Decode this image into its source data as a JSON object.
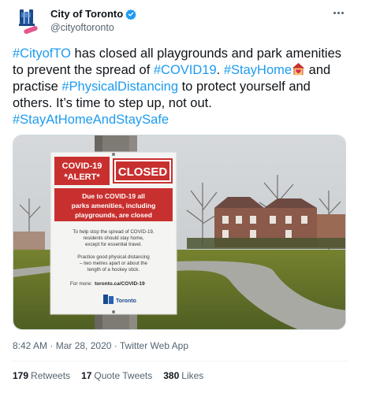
{
  "author": {
    "display_name": "City of Toronto",
    "handle": "@cityoftoronto",
    "verified": true
  },
  "tweet": {
    "segments": [
      {
        "type": "hashtag",
        "text": "#CityofTO"
      },
      {
        "type": "text",
        "text": " has closed all playgrounds and park amenities to prevent the spread of "
      },
      {
        "type": "hashtag",
        "text": "#COVID19"
      },
      {
        "type": "text",
        "text": ". "
      },
      {
        "type": "hashtag",
        "text": "#StayHome"
      },
      {
        "type": "emoji",
        "name": "house-with-heart-icon"
      },
      {
        "type": "text",
        "text": " and practise "
      },
      {
        "type": "hashtag",
        "text": "#PhysicalDistancing"
      },
      {
        "type": "text",
        "text": " to protect yourself and others. It’s time to step up, not out. "
      },
      {
        "type": "hashtag",
        "text": "#StayAtHomeAndStaySafe"
      }
    ]
  },
  "media": {
    "sign": {
      "alert_line1": "COVID-19",
      "alert_line2": "*ALERT*",
      "closed": "CLOSED",
      "banner_line1": "Due to COVID-19 all",
      "banner_line2": "parks amenities, including",
      "banner_line3": "playgrounds, are closed",
      "body1_line1": "To help stop the spread of COVID-19,",
      "body1_line2": "residents should stay home,",
      "body1_line3": "except for essential travel.",
      "body2_line1": "Practice good physical distancing",
      "body2_line2": "– two metres apart or about the",
      "body2_line3": "length of a hockey stick.",
      "more_info_label": "For more:",
      "more_info_link": "toronto.ca/COVID-19",
      "logo_text": "Toronto"
    }
  },
  "meta": {
    "time": "8:42 AM",
    "separator": " · ",
    "date": "Mar 28, 2020",
    "app": "Twitter Web App"
  },
  "stats": {
    "retweets_count": "179",
    "retweets_label": "Retweets",
    "quotes_count": "17",
    "quotes_label": "Quote Tweets",
    "likes_count": "380",
    "likes_label": "Likes"
  },
  "colors": {
    "hashtag": "#1d9bf0",
    "sign_red": "#c8302f",
    "verified": "#1d9bf0"
  }
}
